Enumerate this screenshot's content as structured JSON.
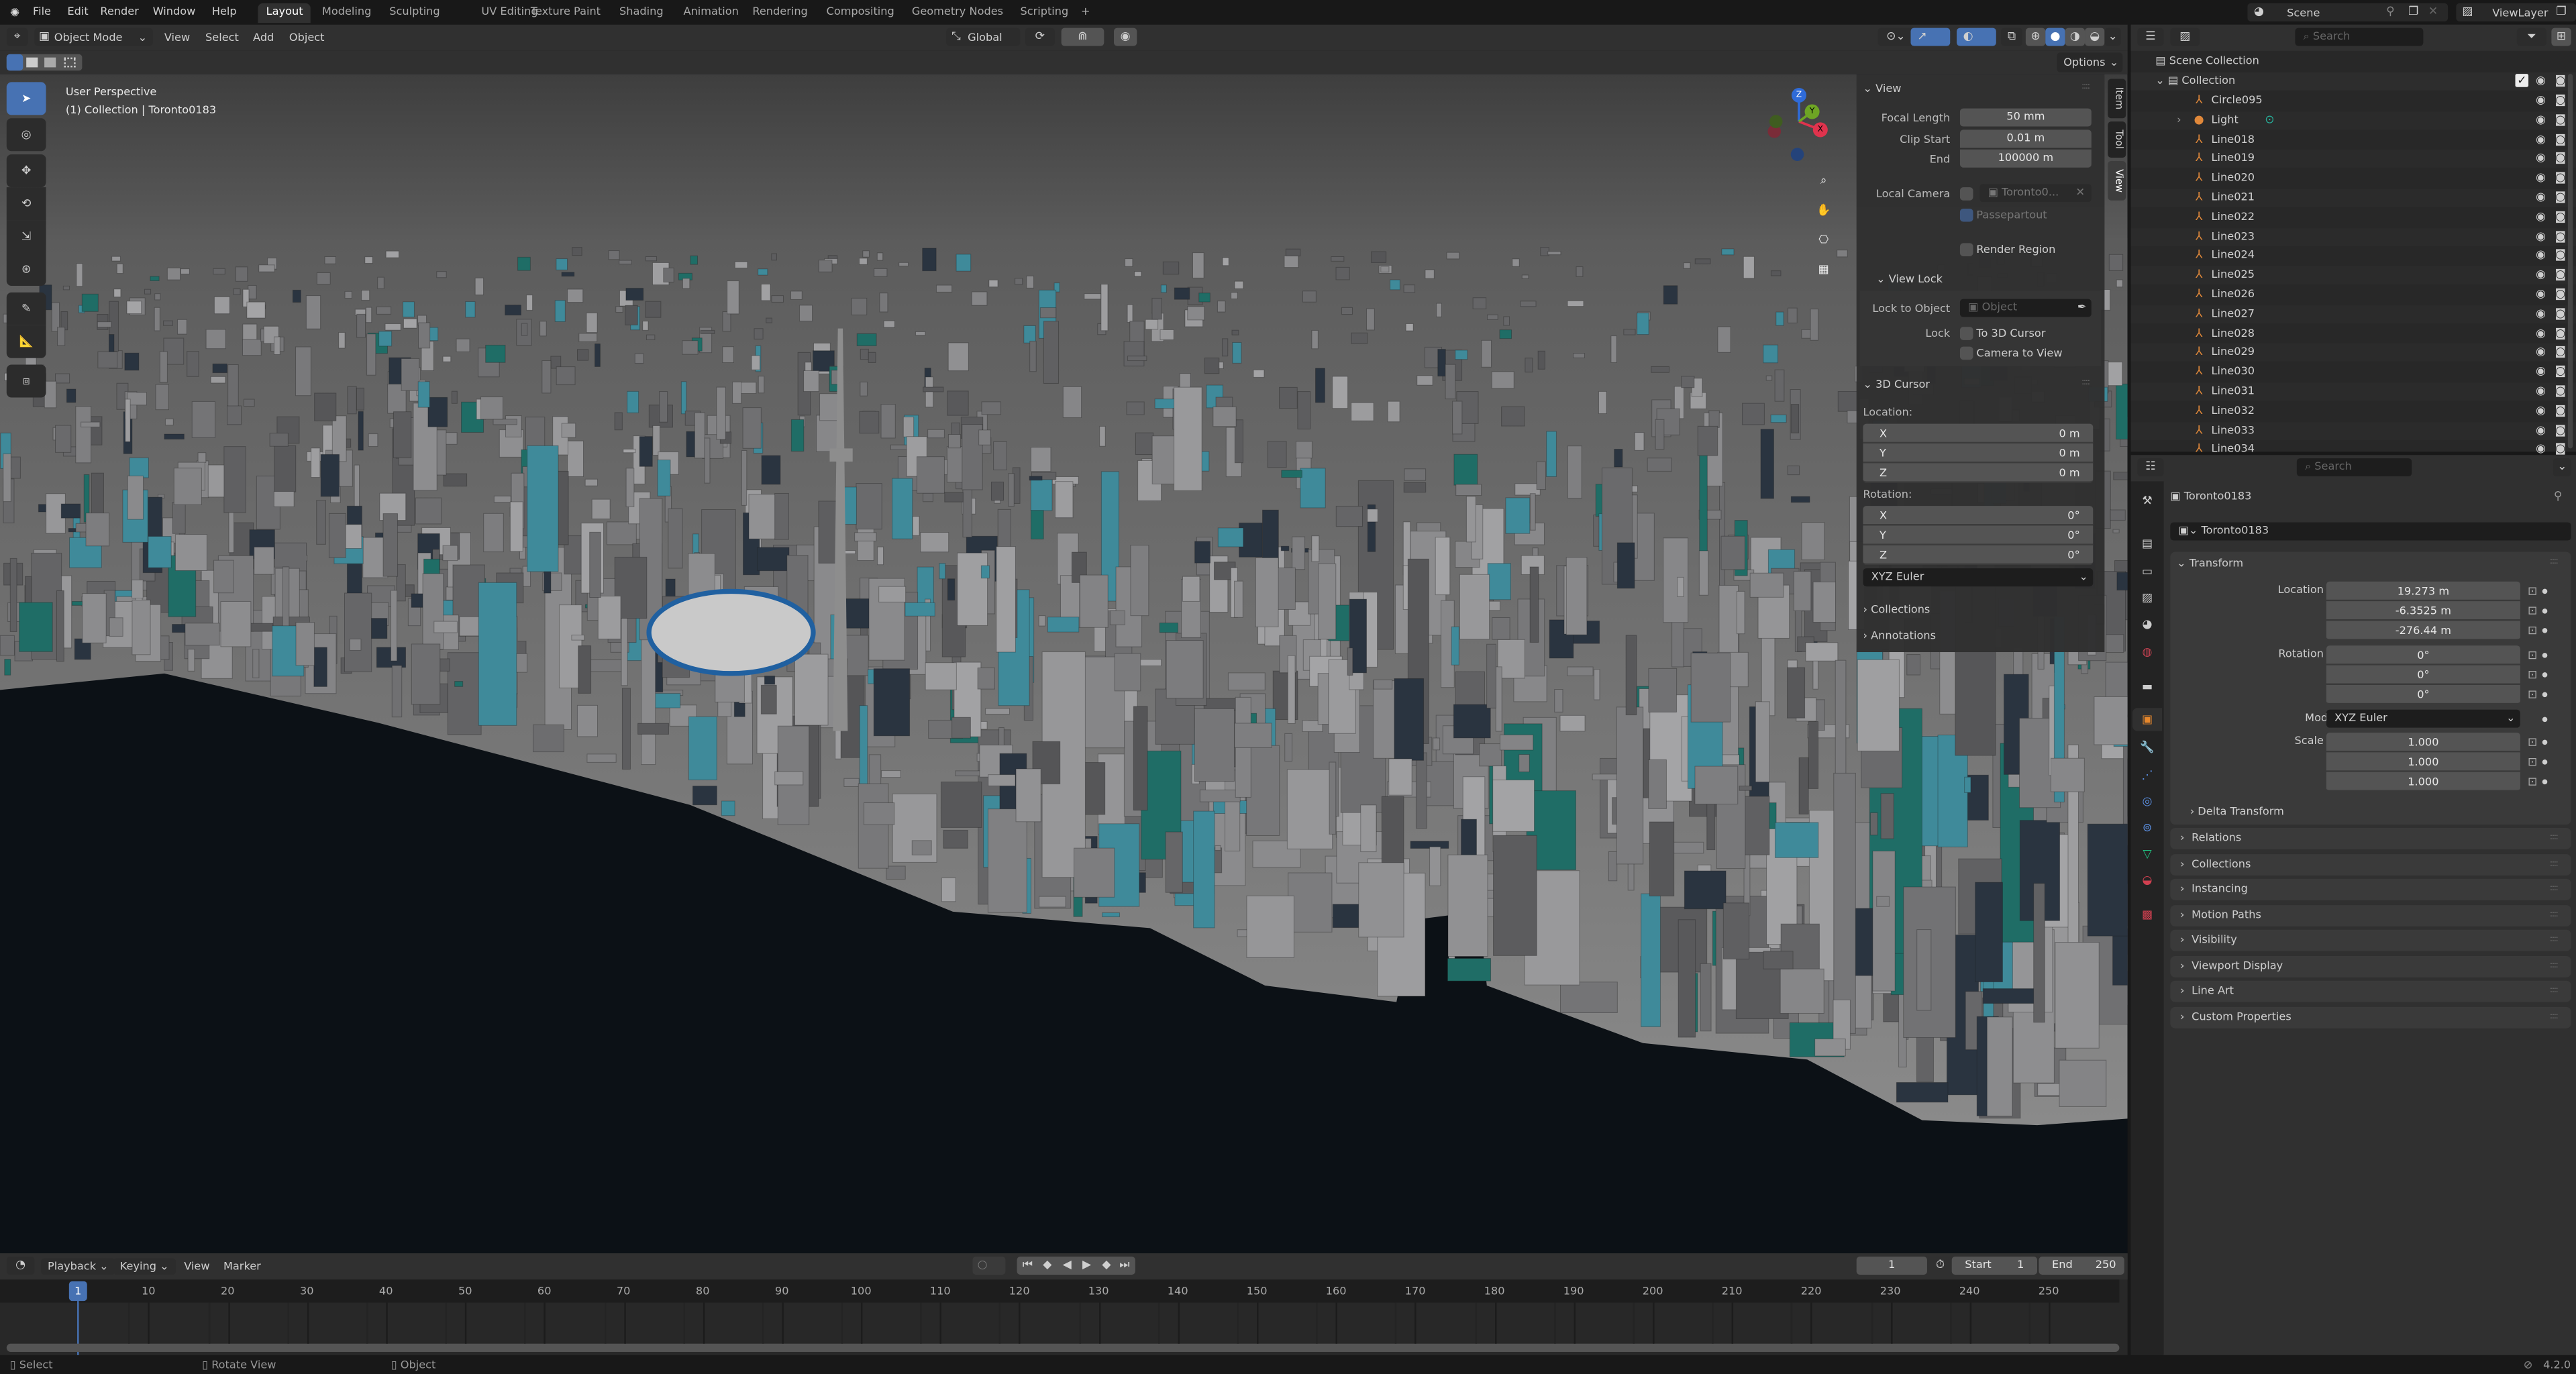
{
  "topbar": {
    "menus": [
      "File",
      "Edit",
      "Render",
      "Window",
      "Help"
    ],
    "workspaces": [
      "Layout",
      "Modeling",
      "Sculpting",
      "UV Editing",
      "Texture Paint",
      "Shading",
      "Animation",
      "Rendering",
      "Compositing",
      "Geometry Nodes",
      "Scripting"
    ],
    "active_workspace": "Layout",
    "add_tab": "+",
    "scene": "Scene",
    "view_layer": "ViewLayer"
  },
  "viewport": {
    "mode": "Object Mode",
    "menus": [
      "View",
      "Select",
      "Add",
      "Object"
    ],
    "orientation": "Global",
    "options_label": "Options",
    "overlay_title": "User Perspective",
    "overlay_subtitle": "(1) Collection | Toronto0183",
    "gizmo_axes": [
      "Z",
      "Y",
      "X"
    ],
    "colors": {
      "water": "#0c1116",
      "sky": "#5b5b5b",
      "accent": "#4772b3"
    }
  },
  "npanel": {
    "tabs": [
      "Item",
      "Tool",
      "View"
    ],
    "view": {
      "title": "View",
      "focal_length_label": "Focal Length",
      "focal_length": "50 mm",
      "clip_start_label": "Clip Start",
      "clip_start": "0.01 m",
      "end_label": "End",
      "end": "100000 m",
      "local_camera_label": "Local Camera",
      "local_camera": "Toronto0...",
      "passepartout": "Passepartout",
      "render_region": "Render Region"
    },
    "view_lock": {
      "title": "View Lock",
      "lock_to_object_label": "Lock to Object",
      "object_placeholder": "Object",
      "lock_label": "Lock",
      "to_3d_cursor": "To 3D Cursor",
      "camera_to_view": "Camera to View"
    },
    "cursor": {
      "title": "3D Cursor",
      "location_label": "Location:",
      "location": [
        {
          "axis": "X",
          "value": "0 m"
        },
        {
          "axis": "Y",
          "value": "0 m"
        },
        {
          "axis": "Z",
          "value": "0 m"
        }
      ],
      "rotation_label": "Rotation:",
      "rotation": [
        {
          "axis": "X",
          "value": "0°"
        },
        {
          "axis": "Y",
          "value": "0°"
        },
        {
          "axis": "Z",
          "value": "0°"
        }
      ],
      "rotation_mode": "XYZ Euler"
    },
    "collapsed": [
      "Collections",
      "Annotations"
    ]
  },
  "outliner": {
    "search_placeholder": "Search",
    "scene_collection": "Scene Collection",
    "collection": "Collection",
    "items": [
      "Circle095",
      "Light",
      "Line018",
      "Line019",
      "Line020",
      "Line021",
      "Line022",
      "Line023",
      "Line024",
      "Line025",
      "Line026",
      "Line027",
      "Line028",
      "Line029",
      "Line030",
      "Line031",
      "Line032",
      "Line033",
      "Line034"
    ]
  },
  "properties": {
    "search_placeholder": "Search",
    "object_name": "Toronto0183",
    "datablock_name": "Toronto0183",
    "transform_title": "Transform",
    "rows": [
      {
        "label": "Location X",
        "value": "19.273 m"
      },
      {
        "label": "Y",
        "value": "-6.3525 m"
      },
      {
        "label": "Z",
        "value": "-276.44 m"
      },
      {
        "label": "Rotation X",
        "value": "0°"
      },
      {
        "label": "Y",
        "value": "0°"
      },
      {
        "label": "Z",
        "value": "0°"
      }
    ],
    "mode_label": "Mode",
    "mode_value": "XYZ Euler",
    "scale_rows": [
      {
        "label": "Scale X",
        "value": "1.000"
      },
      {
        "label": "Y",
        "value": "1.000"
      },
      {
        "label": "Z",
        "value": "1.000"
      }
    ],
    "delta_transform": "Delta Transform",
    "panels": [
      "Relations",
      "Collections",
      "Instancing",
      "Motion Paths",
      "Visibility",
      "Viewport Display",
      "Line Art",
      "Custom Properties"
    ]
  },
  "timeline": {
    "menus": [
      "Playback",
      "Keying",
      "View",
      "Marker"
    ],
    "current_frame": "1",
    "start_label": "Start",
    "start": "1",
    "end_label": "End",
    "end": "250",
    "ticks": [
      "10",
      "20",
      "30",
      "40",
      "50",
      "60",
      "70",
      "80",
      "90",
      "100",
      "110",
      "120",
      "130",
      "140",
      "150",
      "160",
      "170",
      "180",
      "190",
      "200",
      "210",
      "220",
      "230",
      "240",
      "250"
    ],
    "playhead_label": "1"
  },
  "statusbar": {
    "hints": [
      "Select",
      "Rotate View",
      "Object"
    ],
    "version": "4.2.0"
  }
}
